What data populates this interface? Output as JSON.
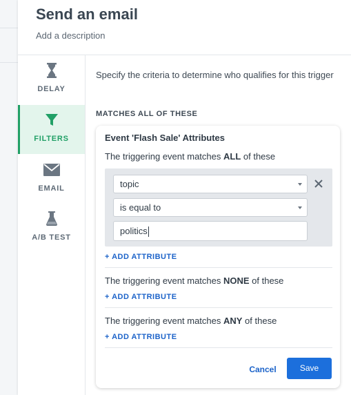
{
  "header": {
    "title": "Send an email",
    "description": "Add a description"
  },
  "nav": [
    {
      "label": "DELAY",
      "icon": "hourglass-icon",
      "active": false
    },
    {
      "label": "FILTERS",
      "icon": "funnel-icon",
      "active": true
    },
    {
      "label": "EMAIL",
      "icon": "envelope-icon",
      "active": false
    },
    {
      "label": "A/B TEST",
      "icon": "flask-icon",
      "active": false
    }
  ],
  "content": {
    "intro": "Specify the criteria to determine who qualifies for this trigger",
    "section_title": "MATCHES ALL OF THESE"
  },
  "card": {
    "title": "Event 'Flash Sale' Attributes",
    "all": {
      "prefix": "The triggering event matches ",
      "keyword": "ALL",
      "suffix": " of these"
    },
    "none": {
      "prefix": "The triggering event matches ",
      "keyword": "NONE",
      "suffix": " of these"
    },
    "any": {
      "prefix": "The triggering event matches ",
      "keyword": "ANY",
      "suffix": " of these"
    },
    "condition": {
      "attribute": "topic",
      "operator": "is equal to",
      "value": "politics"
    },
    "add_attribute": "+ ADD ATTRIBUTE",
    "cancel": "Cancel",
    "save": "Save"
  },
  "colors": {
    "accent_green": "#21a066",
    "link_blue": "#1c63c9",
    "button_blue": "#1c6fdc"
  }
}
